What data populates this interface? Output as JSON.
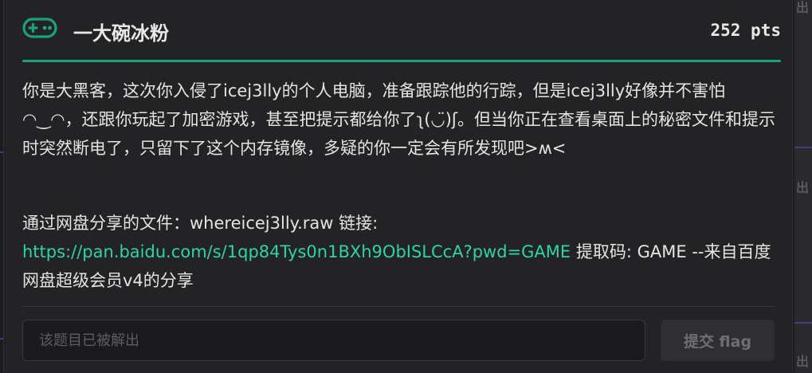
{
  "challenge": {
    "title": "一大碗冰粉",
    "points": "252 pts",
    "description": "你是大黑客，这次你入侵了icej3lly的个人电脑，准备跟踪他的行踪，但是icej3lly好像并不害怕◠‿◠，还跟你玩起了加密游戏，甚至把提示都给你了ʅ(◡̈)ʃ。但当你正在查看桌面上的秘密文件和提示时突然断电了，只留下了这个内存镜像，多疑的你一定会有所发现吧>ʍ<",
    "share_prefix": "通过网盘分享的文件：whereicej3lly.raw 链接: ",
    "share_link": "https://pan.baidu.com/s/1qp84Tys0n1BXh9ObISLCcA?pwd=GAME",
    "share_suffix": " 提取码: GAME --来自百度网盘超级会员v4的分享"
  },
  "flag_form": {
    "placeholder": "该题目已被解出",
    "submit_label": "提交 flag"
  },
  "background": {
    "edge_label": "出"
  },
  "colors": {
    "accent": "#1aa37a",
    "link": "#2fd4a0"
  },
  "icons": {
    "header": "gamepad-icon"
  }
}
